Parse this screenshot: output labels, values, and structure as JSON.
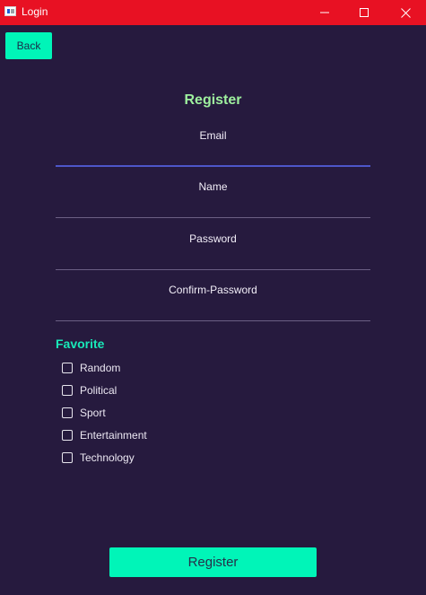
{
  "window": {
    "title": "Login",
    "controls": [
      "minimize-icon",
      "maximize-icon",
      "close-icon"
    ]
  },
  "colors": {
    "background": "#261a3e",
    "titlebar": "#e81123",
    "accent": "#00f5b8",
    "form_title": "#9ef09e",
    "favorite_title": "#19e8b8",
    "active_underline": "#4d56c9"
  },
  "back_button": {
    "label": "Back"
  },
  "form": {
    "title": "Register",
    "fields": {
      "email": {
        "label": "Email",
        "active": true
      },
      "name": {
        "label": "Name"
      },
      "password": {
        "label": "Password"
      },
      "confirm_password": {
        "label": "Confirm-Password"
      }
    }
  },
  "favorite": {
    "title": "Favorite",
    "options": [
      {
        "label": "Random",
        "checked": false
      },
      {
        "label": "Political",
        "checked": false
      },
      {
        "label": "Sport",
        "checked": false
      },
      {
        "label": "Entertainment",
        "checked": false
      },
      {
        "label": "Technology",
        "checked": false
      }
    ]
  },
  "register_button": {
    "label": "Register"
  }
}
